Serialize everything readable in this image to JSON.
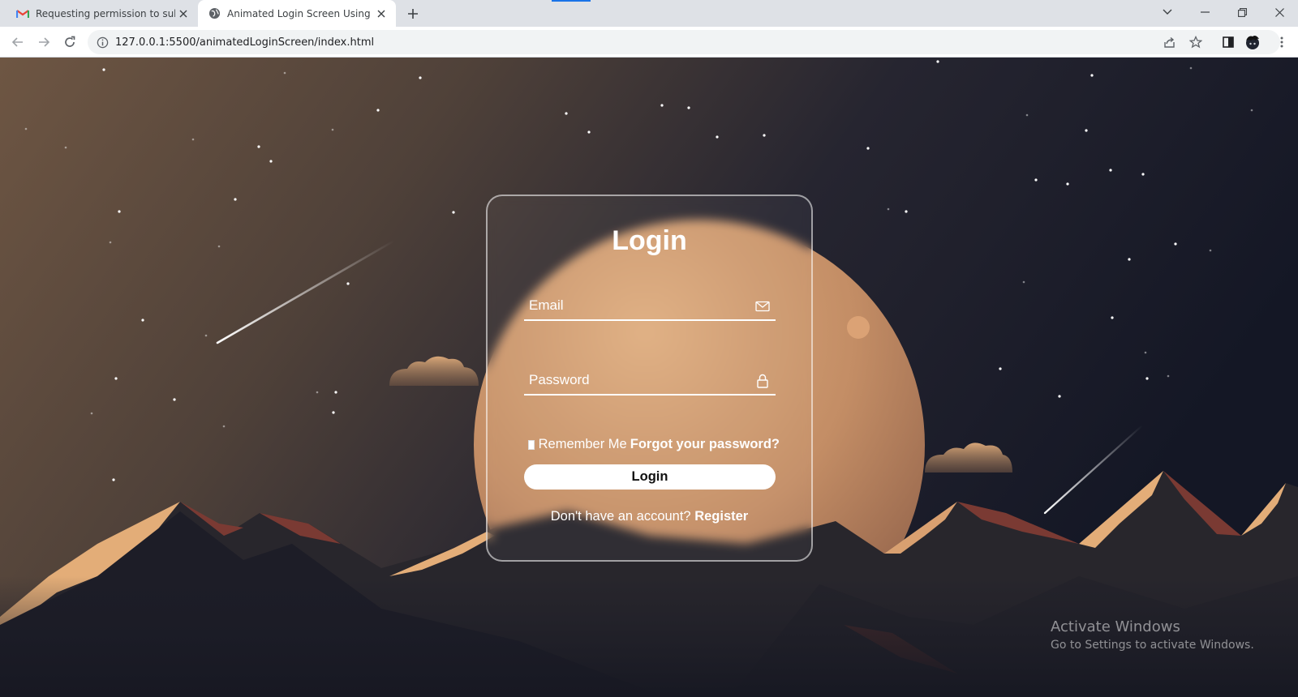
{
  "browser": {
    "tabs": [
      {
        "title": "Requesting permission to submit",
        "icon": "gmail-icon"
      },
      {
        "title": "Animated Login Screen Using HT",
        "icon": "globe-icon"
      }
    ],
    "address": "127.0.0.1:5500/animatedLoginScreen/index.html"
  },
  "login": {
    "title": "Login",
    "email_placeholder": "Email",
    "password_placeholder": "Password",
    "remember_label": "Remember Me",
    "forgot_label": "Forgot your password?",
    "submit_label": "Login",
    "no_account_text": "Don't have an account?",
    "register_label": "Register"
  },
  "watermark": {
    "title": "Activate Windows",
    "subtitle": "Go to Settings to activate Windows."
  },
  "colors": {
    "sky_left": "#6b5440",
    "sky_right": "#151826",
    "planet": "#d9a77a",
    "mountain_highlight": "#e5b07a",
    "mountain_dark": "#1c1c24",
    "mountain_red": "#7a3a33"
  }
}
